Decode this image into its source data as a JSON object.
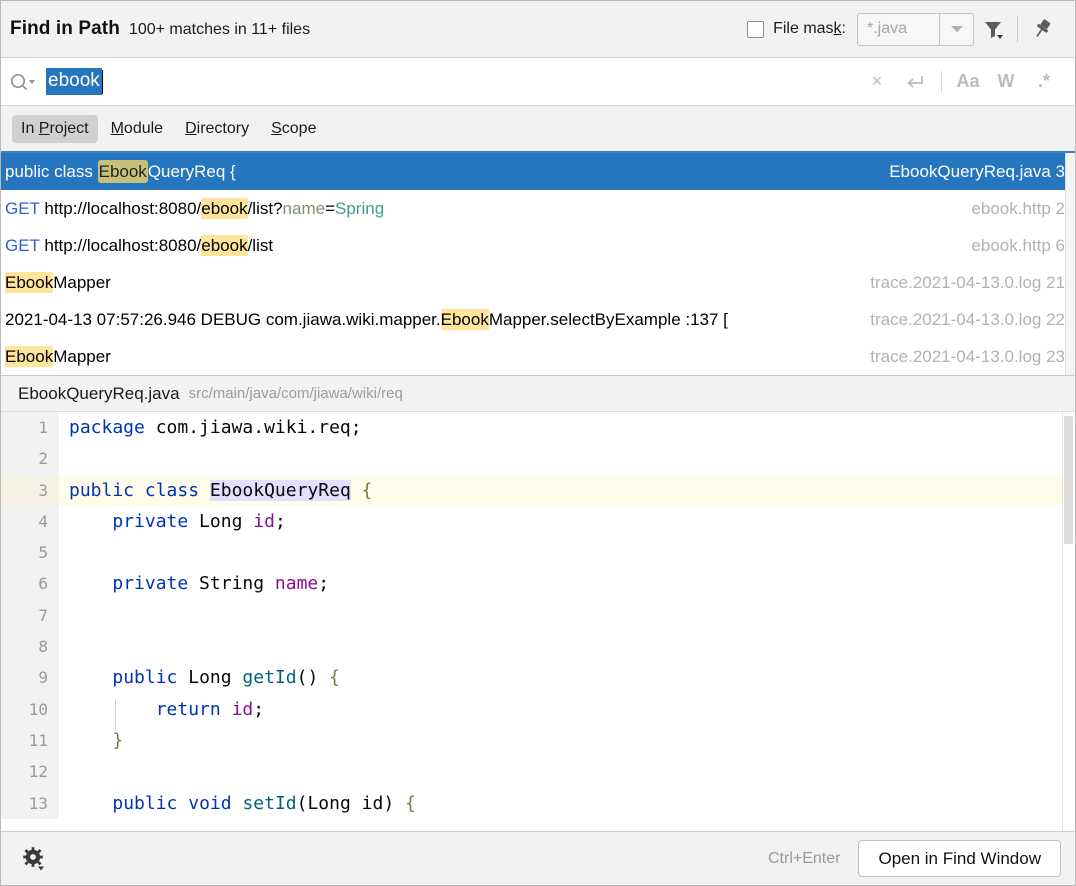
{
  "header": {
    "title": "Find in Path",
    "match_summary": "100+ matches in 11+ files",
    "file_mask_label_a": "File mas",
    "file_mask_label_k": "k",
    "file_mask_label_c": ":",
    "file_mask_value": "*.java",
    "file_mask_checked": false,
    "filter_icon": "filter-icon",
    "pin_icon": "pin-icon"
  },
  "search": {
    "icon": "search-icon",
    "value": "ebook",
    "placeholder": "",
    "clear_label": "×",
    "newline_label": "↵",
    "match_case_label": "Aa",
    "words_label": "W",
    "regex_label": ".*"
  },
  "tabs": [
    {
      "pre": "In ",
      "key": "P",
      "post": "roject",
      "active": true,
      "name": "in-project"
    },
    {
      "pre": "",
      "key": "M",
      "post": "odule",
      "active": false,
      "name": "module"
    },
    {
      "pre": "",
      "key": "D",
      "post": "irectory",
      "active": false,
      "name": "directory"
    },
    {
      "pre": "",
      "key": "S",
      "post": "cope",
      "active": false,
      "name": "scope"
    }
  ],
  "results": [
    {
      "selected": true,
      "file": "EbookQueryReq.java",
      "line_no": "3",
      "parts": [
        {
          "t": "public class ",
          "s": "plain"
        },
        {
          "t": "Ebook",
          "s": "match"
        },
        {
          "t": "QueryReq {",
          "s": "plain"
        }
      ]
    },
    {
      "selected": false,
      "file": "ebook.http",
      "line_no": "2",
      "parts": [
        {
          "t": "GET",
          "s": "get"
        },
        {
          "t": " http://localhost:8080/",
          "s": "plain"
        },
        {
          "t": "ebook",
          "s": "match"
        },
        {
          "t": "/list?",
          "s": "plain"
        },
        {
          "t": "name",
          "s": "attr"
        },
        {
          "t": "=",
          "s": "plain"
        },
        {
          "t": "Spring",
          "s": "val"
        }
      ]
    },
    {
      "selected": false,
      "file": "ebook.http",
      "line_no": "6",
      "parts": [
        {
          "t": "GET",
          "s": "get"
        },
        {
          "t": " http://localhost:8080/",
          "s": "plain"
        },
        {
          "t": "ebook",
          "s": "match"
        },
        {
          "t": "/list",
          "s": "plain"
        }
      ]
    },
    {
      "selected": false,
      "file": "trace.2021-04-13.0.log",
      "line_no": "21",
      "parts": [
        {
          "t": "Ebook",
          "s": "match"
        },
        {
          "t": "Mapper",
          "s": "plain"
        }
      ]
    },
    {
      "selected": false,
      "file": "trace.2021-04-13.0.log",
      "line_no": "22",
      "parts": [
        {
          "t": "2021-04-13 07:57:26.946 DEBUG com.jiawa.wiki.mapper.",
          "s": "plain"
        },
        {
          "t": "Ebook",
          "s": "match"
        },
        {
          "t": "Mapper.selectByExample :137  [",
          "s": "plain"
        }
      ]
    },
    {
      "selected": false,
      "file": "trace.2021-04-13.0.log",
      "line_no": "23",
      "parts": [
        {
          "t": "Ebook",
          "s": "match"
        },
        {
          "t": "Mapper",
          "s": "plain"
        }
      ]
    }
  ],
  "preview": {
    "file_name": "EbookQueryReq.java",
    "file_path": "src/main/java/com/jiawa/wiki/req",
    "lines": [
      {
        "n": "1",
        "hi": false,
        "parts": [
          {
            "t": "package",
            "s": "kw"
          },
          {
            "t": " com.jiawa.wiki.req;",
            "s": "plain"
          }
        ]
      },
      {
        "n": "2",
        "hi": false,
        "parts": [
          {
            "t": "",
            "s": "plain"
          }
        ]
      },
      {
        "n": "3",
        "hi": true,
        "parts": [
          {
            "t": "public",
            "s": "kw"
          },
          {
            "t": " ",
            "s": "plain"
          },
          {
            "t": "class",
            "s": "kw"
          },
          {
            "t": " ",
            "s": "plain"
          },
          {
            "t": "EbookQueryReq",
            "s": "sel"
          },
          {
            "t": " ",
            "s": "plain"
          },
          {
            "t": "{",
            "s": "br"
          }
        ]
      },
      {
        "n": "4",
        "hi": false,
        "parts": [
          {
            "t": "    ",
            "s": "plain"
          },
          {
            "t": "private",
            "s": "kw"
          },
          {
            "t": " Long ",
            "s": "plain"
          },
          {
            "t": "id",
            "s": "fld"
          },
          {
            "t": ";",
            "s": "plain"
          }
        ]
      },
      {
        "n": "5",
        "hi": false,
        "parts": [
          {
            "t": "",
            "s": "plain"
          }
        ]
      },
      {
        "n": "6",
        "hi": false,
        "parts": [
          {
            "t": "    ",
            "s": "plain"
          },
          {
            "t": "private",
            "s": "kw"
          },
          {
            "t": " String ",
            "s": "plain"
          },
          {
            "t": "name",
            "s": "fld"
          },
          {
            "t": ";",
            "s": "plain"
          }
        ]
      },
      {
        "n": "7",
        "hi": false,
        "parts": [
          {
            "t": "",
            "s": "plain"
          }
        ]
      },
      {
        "n": "8",
        "hi": false,
        "parts": [
          {
            "t": "",
            "s": "plain"
          }
        ]
      },
      {
        "n": "9",
        "hi": false,
        "parts": [
          {
            "t": "    ",
            "s": "plain"
          },
          {
            "t": "public",
            "s": "kw"
          },
          {
            "t": " Long ",
            "s": "plain"
          },
          {
            "t": "getId",
            "s": "mth"
          },
          {
            "t": "() ",
            "s": "plain"
          },
          {
            "t": "{",
            "s": "br"
          }
        ]
      },
      {
        "n": "10",
        "hi": false,
        "parts": [
          {
            "t": "        ",
            "s": "plain"
          },
          {
            "t": "return",
            "s": "kw"
          },
          {
            "t": " ",
            "s": "plain"
          },
          {
            "t": "id",
            "s": "fld"
          },
          {
            "t": ";",
            "s": "plain"
          }
        ]
      },
      {
        "n": "11",
        "hi": false,
        "parts": [
          {
            "t": "    ",
            "s": "plain"
          },
          {
            "t": "}",
            "s": "br"
          }
        ]
      },
      {
        "n": "12",
        "hi": false,
        "parts": [
          {
            "t": "",
            "s": "plain"
          }
        ]
      },
      {
        "n": "13",
        "hi": false,
        "parts": [
          {
            "t": "    ",
            "s": "plain"
          },
          {
            "t": "public",
            "s": "kw"
          },
          {
            "t": " ",
            "s": "plain"
          },
          {
            "t": "void",
            "s": "kw"
          },
          {
            "t": " ",
            "s": "plain"
          },
          {
            "t": "setId",
            "s": "mth"
          },
          {
            "t": "(Long id) ",
            "s": "plain"
          },
          {
            "t": "{",
            "s": "br"
          }
        ]
      }
    ]
  },
  "footer": {
    "settings_icon": "gear-icon",
    "shortcut": "Ctrl+Enter",
    "open_button": "Open in Find Window"
  },
  "colors": {
    "selection_blue": "#2675bf",
    "match_yellow": "#ffe49b",
    "match_olive": "#c8c078",
    "tab_underline": "#3f7fc1",
    "panel_gray": "#f2f2f2"
  }
}
